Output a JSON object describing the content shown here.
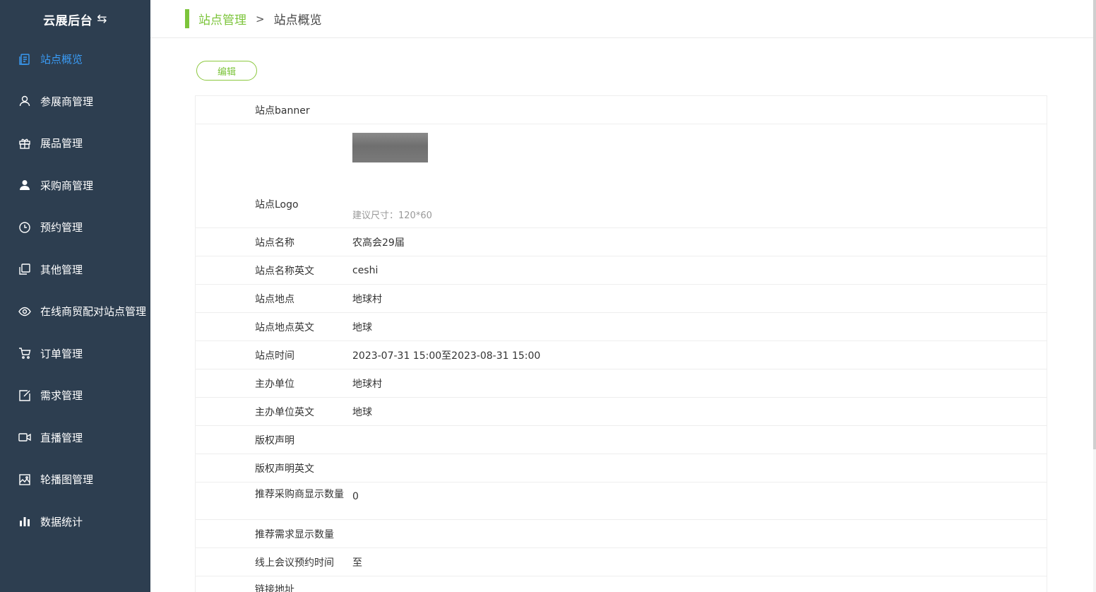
{
  "app": {
    "title": "云展后台",
    "swap_icon": "⇆"
  },
  "sidebar": {
    "items": [
      {
        "label": "站点概览",
        "icon": "overview-icon",
        "active": true
      },
      {
        "label": "参展商管理",
        "icon": "user-icon"
      },
      {
        "label": "展品管理",
        "icon": "gift-icon"
      },
      {
        "label": "采购商管理",
        "icon": "person-filled-icon"
      },
      {
        "label": "预约管理",
        "icon": "clock-icon"
      },
      {
        "label": "其他管理",
        "icon": "copy-icon"
      },
      {
        "label": "在线商贸配对站点管理",
        "icon": "eye-icon"
      },
      {
        "label": "订单管理",
        "icon": "cart-icon"
      },
      {
        "label": "需求管理",
        "icon": "edit-icon"
      },
      {
        "label": "直播管理",
        "icon": "video-icon"
      },
      {
        "label": "轮播图管理",
        "icon": "image-icon"
      },
      {
        "label": "数据统计",
        "icon": "bar-chart-icon"
      }
    ]
  },
  "breadcrumb": {
    "parent": "站点管理",
    "separator": ">",
    "current": "站点概览"
  },
  "actions": {
    "edit_label": "编辑"
  },
  "detail": {
    "banner_label": "站点banner",
    "logo_label": "站点Logo",
    "logo_hint": "建议尺寸：120*60",
    "rows": [
      {
        "label": "站点名称",
        "value": "农高会29届"
      },
      {
        "label": "站点名称英文",
        "value": "ceshi"
      },
      {
        "label": "站点地点",
        "value": "地球村"
      },
      {
        "label": "站点地点英文",
        "value": "地球"
      },
      {
        "label": "站点时间",
        "value": "2023-07-31 15:00至2023-08-31 15:00"
      },
      {
        "label": "主办单位",
        "value": "地球村"
      },
      {
        "label": "主办单位英文",
        "value": "地球"
      },
      {
        "label": "版权声明",
        "value": ""
      },
      {
        "label": "版权声明英文",
        "value": ""
      }
    ],
    "recommend_buyer": {
      "label": "推荐采购商显示数量",
      "value": "0"
    },
    "recommend_demand": {
      "label": "推荐需求显示数量",
      "value": ""
    },
    "meeting_time": {
      "label": "线上会议预约时间",
      "value": "至"
    },
    "link": {
      "label": "链接地址",
      "value": ""
    }
  },
  "colors": {
    "sidebar_bg": "#2d3e50",
    "active_nav": "#3a9cf6",
    "accent_green": "#7cc43b"
  }
}
